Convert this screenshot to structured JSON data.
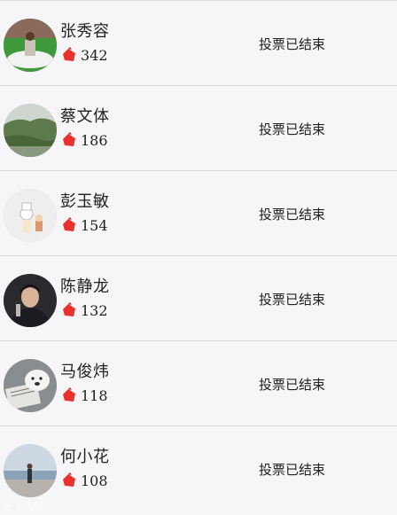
{
  "candidates": [
    {
      "name": "张秀容",
      "votes": "342",
      "status": "投票已结束",
      "avatar": "green-field-avatar"
    },
    {
      "name": "蔡文体",
      "votes": "186",
      "status": "投票已结束",
      "avatar": "landscape-avatar"
    },
    {
      "name": "彭玉敏",
      "votes": "154",
      "status": "投票已结束",
      "avatar": "chef-toys-avatar"
    },
    {
      "name": "陈静龙",
      "votes": "132",
      "status": "投票已结束",
      "avatar": "man-portrait-avatar"
    },
    {
      "name": "马俊炜",
      "votes": "118",
      "status": "投票已结束",
      "avatar": "bear-book-avatar"
    },
    {
      "name": "何小花",
      "votes": "108",
      "status": "投票已结束",
      "avatar": "beach-person-avatar"
    }
  ],
  "vote_icon": "red-hand-icon",
  "colors": {
    "background": "#f4f3f6",
    "divider": "#d8d8d8",
    "vote_icon": "#e8322f",
    "text": "#222222"
  },
  "watermark": "迷 入选图"
}
